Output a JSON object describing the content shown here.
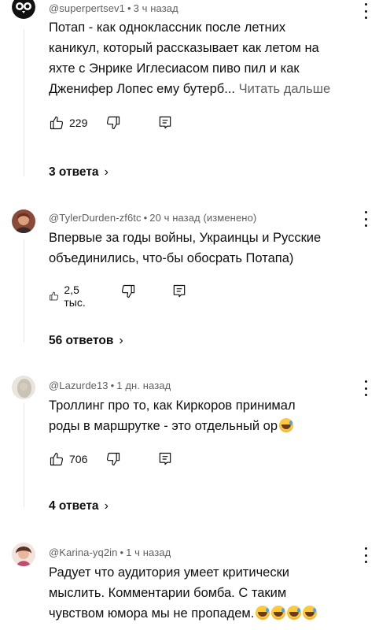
{
  "comments": [
    {
      "author": "@superpertsev1",
      "time": "3 ч назад",
      "text": "Потап - как одноклассник после летних\nканикул, который рассказывает как летом на\nяхте с Энрике Иглесиасом пиво пил и как\nДженифер Лопес ему бутерб...",
      "read_more": "Читать дальше",
      "likes": "229",
      "replies": "3 ответа",
      "avatar": "owl-logo-avatar"
    },
    {
      "author": "@TylerDurden-zf6tc",
      "time": "20 ч назад (изменено)",
      "text": "Впервые за годы войны, Украинцы и Русские\nобъединились, что-бы обосрать Потапа)",
      "likes": "2,5 тыс.",
      "replies": "56 ответов",
      "avatar": "photo-avatar"
    },
    {
      "author": "@Lazurde13",
      "time": "1 дн. назад",
      "text": "Троллинг про то, как Киркоров принимал\nроды в маршрутке - это отдельный ор",
      "likes": "706",
      "replies": "4 ответа",
      "avatar": "photo-avatar"
    },
    {
      "author": "@Karina-yq2in",
      "time": "1 ч назад",
      "text": "Радует что аудитория умеет критически\nмыслить. Комментарии бомба. С таким\nчувством юмора мы не пропадем.",
      "avatar": "photo-avatar"
    }
  ],
  "icons": {
    "like": "thumb-up-icon",
    "dislike": "thumb-down-icon",
    "reply": "reply-icon",
    "more": "more-vertical-icon",
    "chevron": "chevron-right-icon",
    "emoji": "sweat-smile-emoji"
  }
}
